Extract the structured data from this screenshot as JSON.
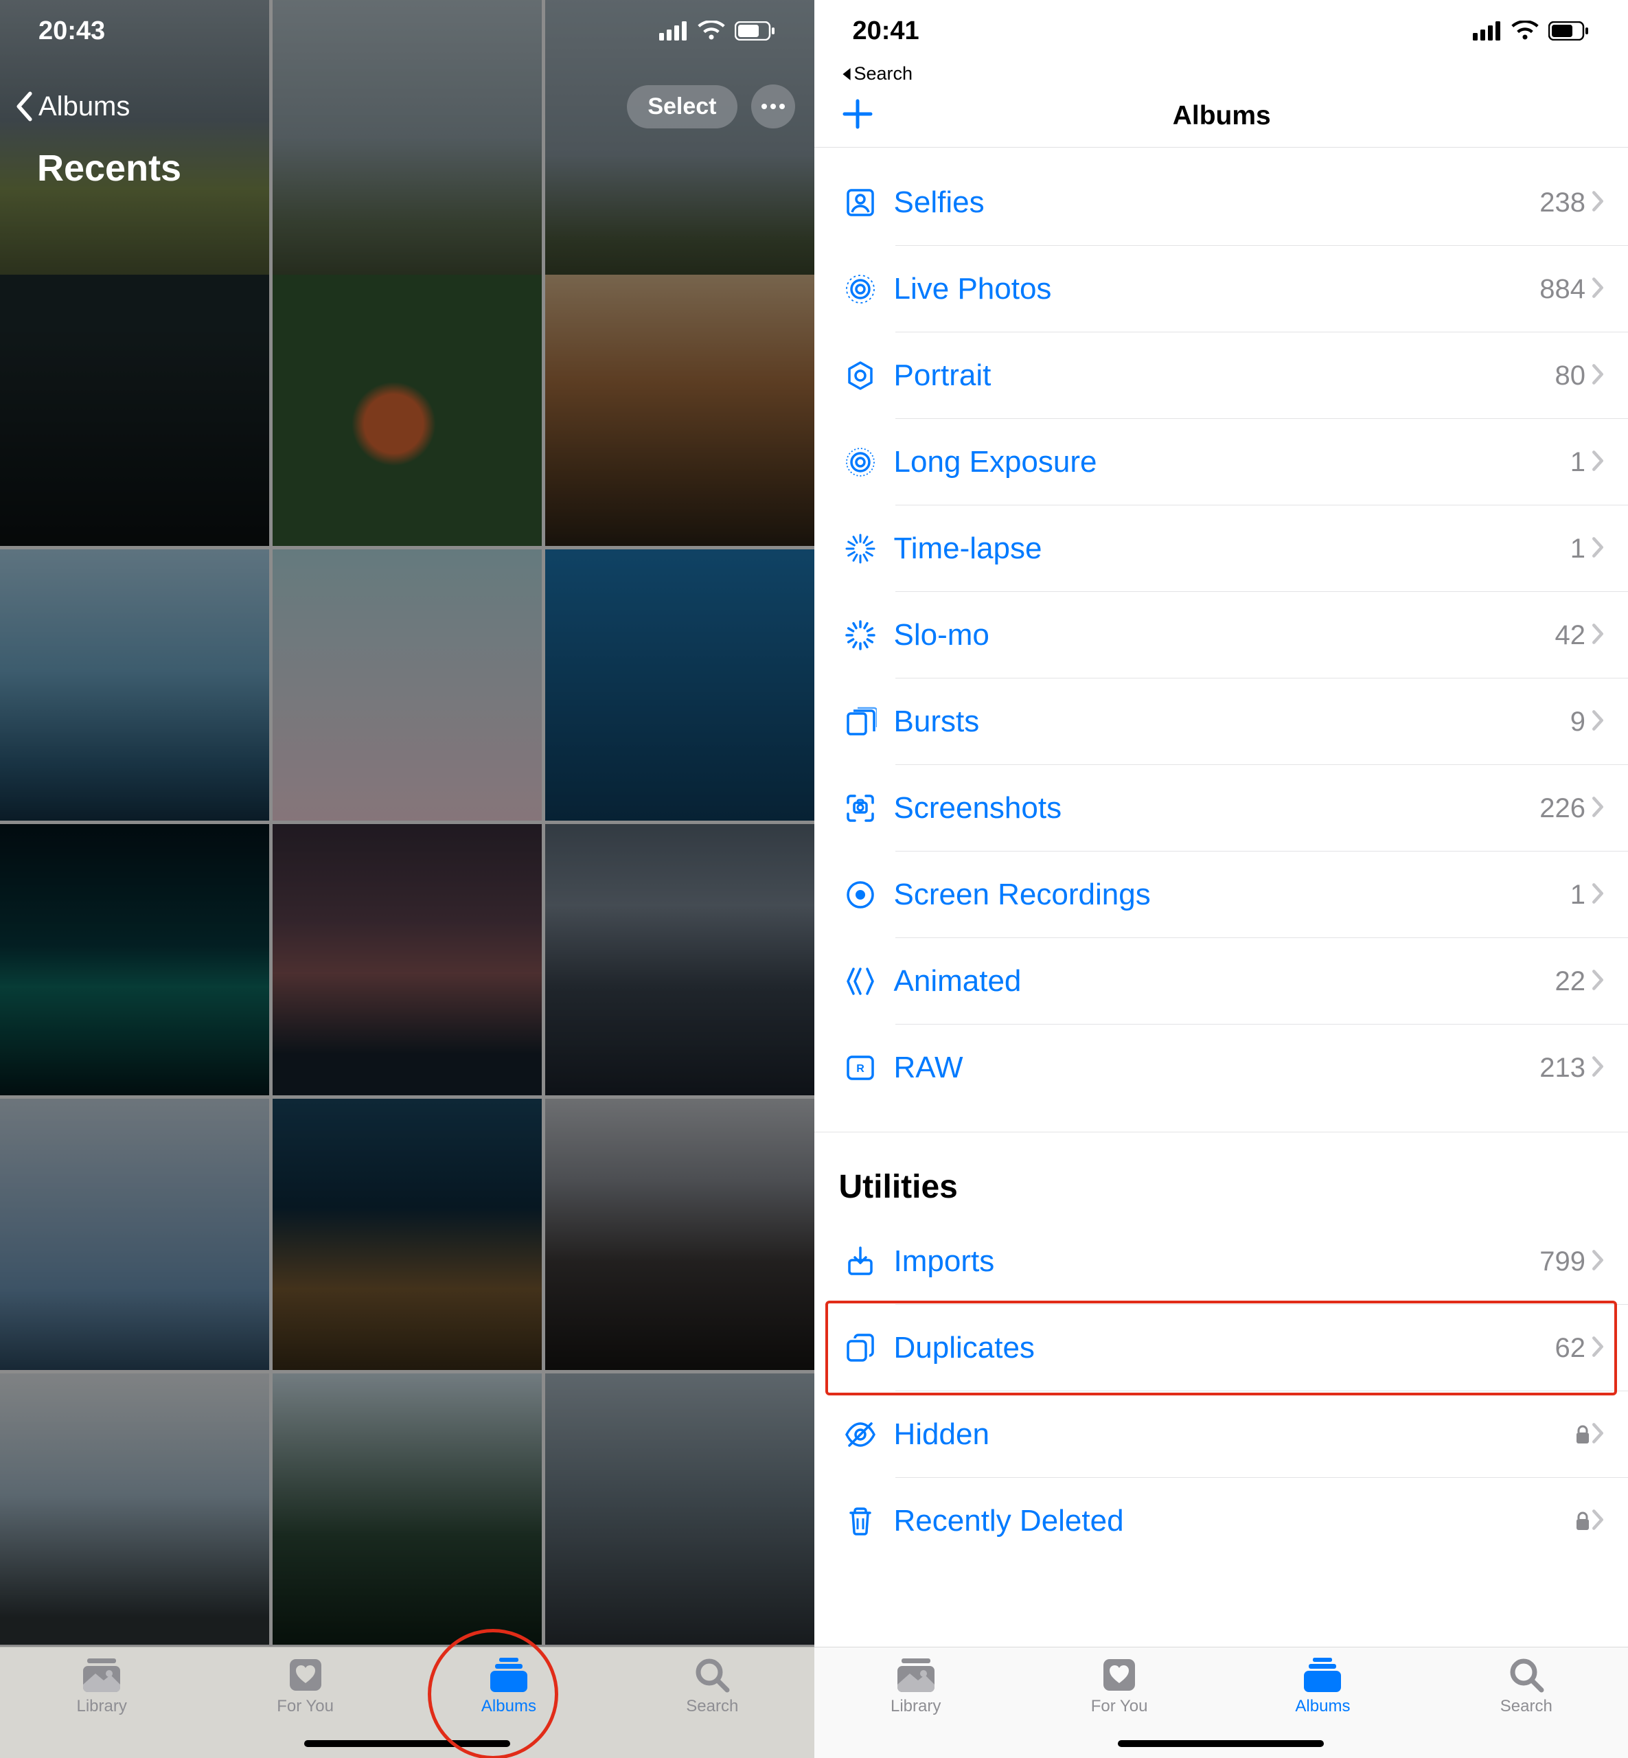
{
  "left": {
    "status_time": "20:43",
    "back_label": "Albums",
    "title": "Recents",
    "select_label": "Select",
    "tabs": {
      "library": "Library",
      "for_you": "For You",
      "albums": "Albums",
      "search": "Search"
    }
  },
  "right": {
    "status_time": "20:41",
    "breadcrumb": "Search",
    "nav_title": "Albums",
    "rows": [
      {
        "icon": "selfies",
        "label": "Selfies",
        "count": "238"
      },
      {
        "icon": "live",
        "label": "Live Photos",
        "count": "884"
      },
      {
        "icon": "portrait",
        "label": "Portrait",
        "count": "80"
      },
      {
        "icon": "longexp",
        "label": "Long Exposure",
        "count": "1"
      },
      {
        "icon": "timelapse",
        "label": "Time-lapse",
        "count": "1"
      },
      {
        "icon": "slomo",
        "label": "Slo-mo",
        "count": "42"
      },
      {
        "icon": "bursts",
        "label": "Bursts",
        "count": "9"
      },
      {
        "icon": "screenshots",
        "label": "Screenshots",
        "count": "226"
      },
      {
        "icon": "screenrec",
        "label": "Screen Recordings",
        "count": "1"
      },
      {
        "icon": "animated",
        "label": "Animated",
        "count": "22"
      },
      {
        "icon": "raw",
        "label": "RAW",
        "count": "213"
      }
    ],
    "utilities_header": "Utilities",
    "utilities": [
      {
        "icon": "imports",
        "label": "Imports",
        "count": "799",
        "lock": false
      },
      {
        "icon": "duplicates",
        "label": "Duplicates",
        "count": "62",
        "lock": false,
        "highlight": true
      },
      {
        "icon": "hidden",
        "label": "Hidden",
        "count": "",
        "lock": true
      },
      {
        "icon": "deleted",
        "label": "Recently Deleted",
        "count": "",
        "lock": true
      }
    ],
    "tabs": {
      "library": "Library",
      "for_you": "For You",
      "albums": "Albums",
      "search": "Search"
    }
  }
}
